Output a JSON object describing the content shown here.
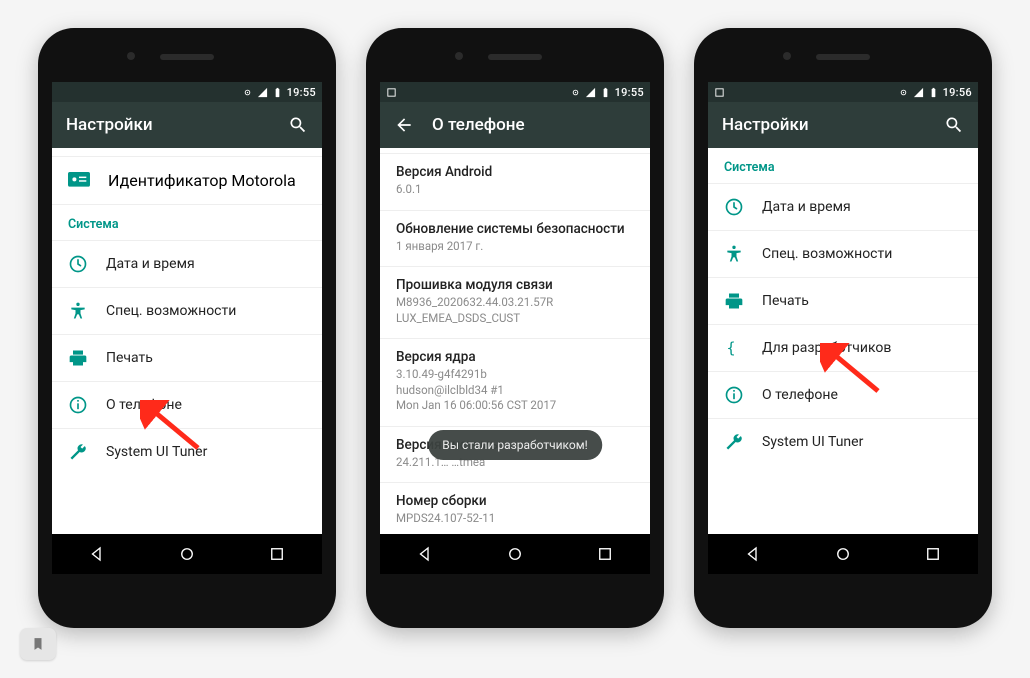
{
  "phones": [
    {
      "status": {
        "time": "19:55",
        "showScreenshot": false
      },
      "appbar": {
        "mode": "settings",
        "title": "Настройки"
      },
      "topRow": {
        "label": "Идентификатор Motorola"
      },
      "sectionHeader": "Система",
      "rows": [
        {
          "icon": "clock",
          "label": "Дата и время"
        },
        {
          "icon": "access",
          "label": "Спец. возможности"
        },
        {
          "icon": "print",
          "label": "Печать"
        },
        {
          "icon": "info",
          "label": "О телефоне"
        },
        {
          "icon": "wrench",
          "label": "System UI Tuner"
        }
      ],
      "arrow": {
        "target": 3
      }
    },
    {
      "status": {
        "time": "19:55",
        "showScreenshot": true
      },
      "appbar": {
        "mode": "about",
        "title": "О телефоне"
      },
      "infoRows": [
        {
          "t": "Версия Android",
          "s": "6.0.1"
        },
        {
          "t": "Обновление системы безопасности",
          "s": "1 января 2017 г."
        },
        {
          "t": "Прошивка модуля связи",
          "s": "M8936_2020632.44.03.21.57R\nLUX_EMEA_DSDS_CUST"
        },
        {
          "t": "Версия ядра",
          "s": "3.10.49-g4f4291b\nhudson@ilclbld34 #1\nMon Jan 16 06:00:56 CST 2017"
        },
        {
          "t": "Версия системы",
          "s": "24.211.1…                                               …tmea"
        },
        {
          "t": "Номер сборки",
          "s": "MPDS24.107-52-11"
        }
      ],
      "toast": "Вы стали разработчиком!"
    },
    {
      "status": {
        "time": "19:56",
        "showScreenshot": true
      },
      "appbar": {
        "mode": "settings",
        "title": "Настройки"
      },
      "sectionHeader": "Система",
      "rows": [
        {
          "icon": "clock",
          "label": "Дата и время"
        },
        {
          "icon": "access",
          "label": "Спец. возможности"
        },
        {
          "icon": "print",
          "label": "Печать"
        },
        {
          "icon": "braces",
          "label": "Для разработчиков"
        },
        {
          "icon": "info",
          "label": "О телефоне"
        },
        {
          "icon": "wrench",
          "label": "System UI Tuner"
        }
      ],
      "arrow": {
        "target": 3
      }
    }
  ]
}
